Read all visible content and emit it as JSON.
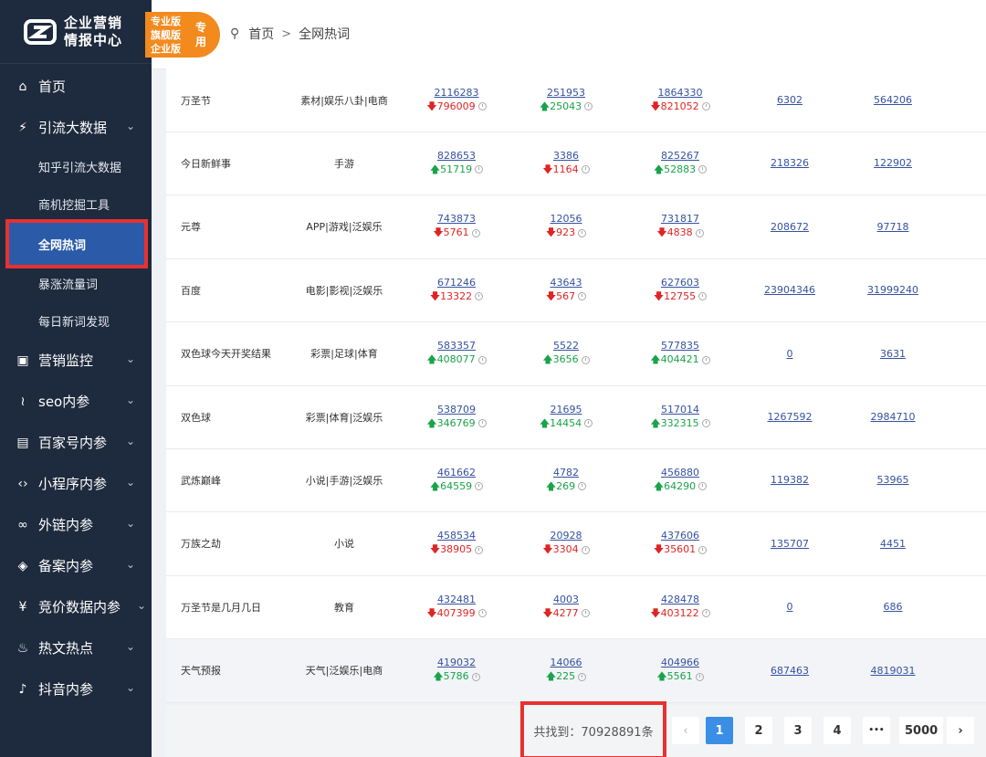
{
  "logo": {
    "line1": "企业营销",
    "line2": "情报中心"
  },
  "badge": {
    "lines": [
      "专业版",
      "旗舰版",
      "企业版"
    ],
    "side": "专用"
  },
  "breadcrumb": {
    "home": "首页",
    "sep": ">",
    "current": "全网热词"
  },
  "sidebar": {
    "home": "首页",
    "traffic": "引流大数据",
    "sub": [
      "知乎引流大数据",
      "商机挖掘工具",
      "全网热词",
      "暴涨流量词",
      "每日新词发现"
    ],
    "menus": [
      "营销监控",
      "seo内参",
      "百家号内参",
      "小程序内参",
      "外链内参",
      "备案内参",
      "竞价数据内参",
      "热文热点",
      "抖音内参"
    ]
  },
  "rows": [
    {
      "kw": "万圣节",
      "cat": "素材|娱乐八卦|电商",
      "v1": "2116283",
      "d1": "796009",
      "u1": false,
      "v2": "251953",
      "d2": "25043",
      "u2": true,
      "v3": "1864330",
      "d3": "821052",
      "u3": false,
      "v4": "6302",
      "v5": "564206"
    },
    {
      "kw": "今日新鲜事",
      "cat": "手游",
      "v1": "828653",
      "d1": "51719",
      "u1": true,
      "v2": "3386",
      "d2": "1164",
      "u2": false,
      "v3": "825267",
      "d3": "52883",
      "u3": true,
      "v4": "218326",
      "v5": "122902"
    },
    {
      "kw": "元尊",
      "cat": "APP|游戏|泛娱乐",
      "v1": "743873",
      "d1": "5761",
      "u1": false,
      "v2": "12056",
      "d2": "923",
      "u2": false,
      "v3": "731817",
      "d3": "4838",
      "u3": false,
      "v4": "208672",
      "v5": "97718"
    },
    {
      "kw": "百度",
      "cat": "电影|影视|泛娱乐",
      "v1": "671246",
      "d1": "13322",
      "u1": false,
      "v2": "43643",
      "d2": "567",
      "u2": false,
      "v3": "627603",
      "d3": "12755",
      "u3": false,
      "v4": "23904346",
      "v5": "31999240"
    },
    {
      "kw": "双色球今天开奖结果",
      "cat": "彩票|足球|体育",
      "v1": "583357",
      "d1": "408077",
      "u1": true,
      "v2": "5522",
      "d2": "3656",
      "u2": true,
      "v3": "577835",
      "d3": "404421",
      "u3": true,
      "v4": "0",
      "v5": "3631"
    },
    {
      "kw": "双色球",
      "cat": "彩票|体育|泛娱乐",
      "v1": "538709",
      "d1": "346769",
      "u1": true,
      "v2": "21695",
      "d2": "14454",
      "u2": true,
      "v3": "517014",
      "d3": "332315",
      "u3": true,
      "v4": "1267592",
      "v5": "2984710"
    },
    {
      "kw": "武炼巅峰",
      "cat": "小说|手游|泛娱乐",
      "v1": "461662",
      "d1": "64559",
      "u1": true,
      "v2": "4782",
      "d2": "269",
      "u2": true,
      "v3": "456880",
      "d3": "64290",
      "u3": true,
      "v4": "119382",
      "v5": "53965"
    },
    {
      "kw": "万族之劫",
      "cat": "小说",
      "v1": "458534",
      "d1": "38905",
      "u1": false,
      "v2": "20928",
      "d2": "3304",
      "u2": false,
      "v3": "437606",
      "d3": "35601",
      "u3": false,
      "v4": "135707",
      "v5": "4451"
    },
    {
      "kw": "万圣节是几月几日",
      "cat": "教育",
      "v1": "432481",
      "d1": "407399",
      "u1": false,
      "v2": "4003",
      "d2": "4277",
      "u2": false,
      "v3": "428478",
      "d3": "403122",
      "u3": false,
      "v4": "0",
      "v5": "686"
    },
    {
      "kw": "天气预报",
      "cat": "天气|泛娱乐|电商",
      "v1": "419032",
      "d1": "5786",
      "u1": true,
      "v2": "14066",
      "d2": "225",
      "u2": true,
      "v3": "404966",
      "d3": "5561",
      "u3": true,
      "v4": "687463",
      "v5": "4819031"
    }
  ],
  "pager": {
    "total": "共找到：70928891条",
    "prev": "‹",
    "pages": [
      "1",
      "2",
      "3",
      "4"
    ],
    "ellipsis": "•••",
    "last": "5000",
    "next": "›",
    "active": "1"
  },
  "colors": {
    "sidebar": "#1e2a3d",
    "active": "#2a5aa8",
    "up": "#1aa34a",
    "down": "#e02424",
    "link": "#3552a0",
    "badge": "#f28a1e",
    "highlight": "#e8312f"
  }
}
